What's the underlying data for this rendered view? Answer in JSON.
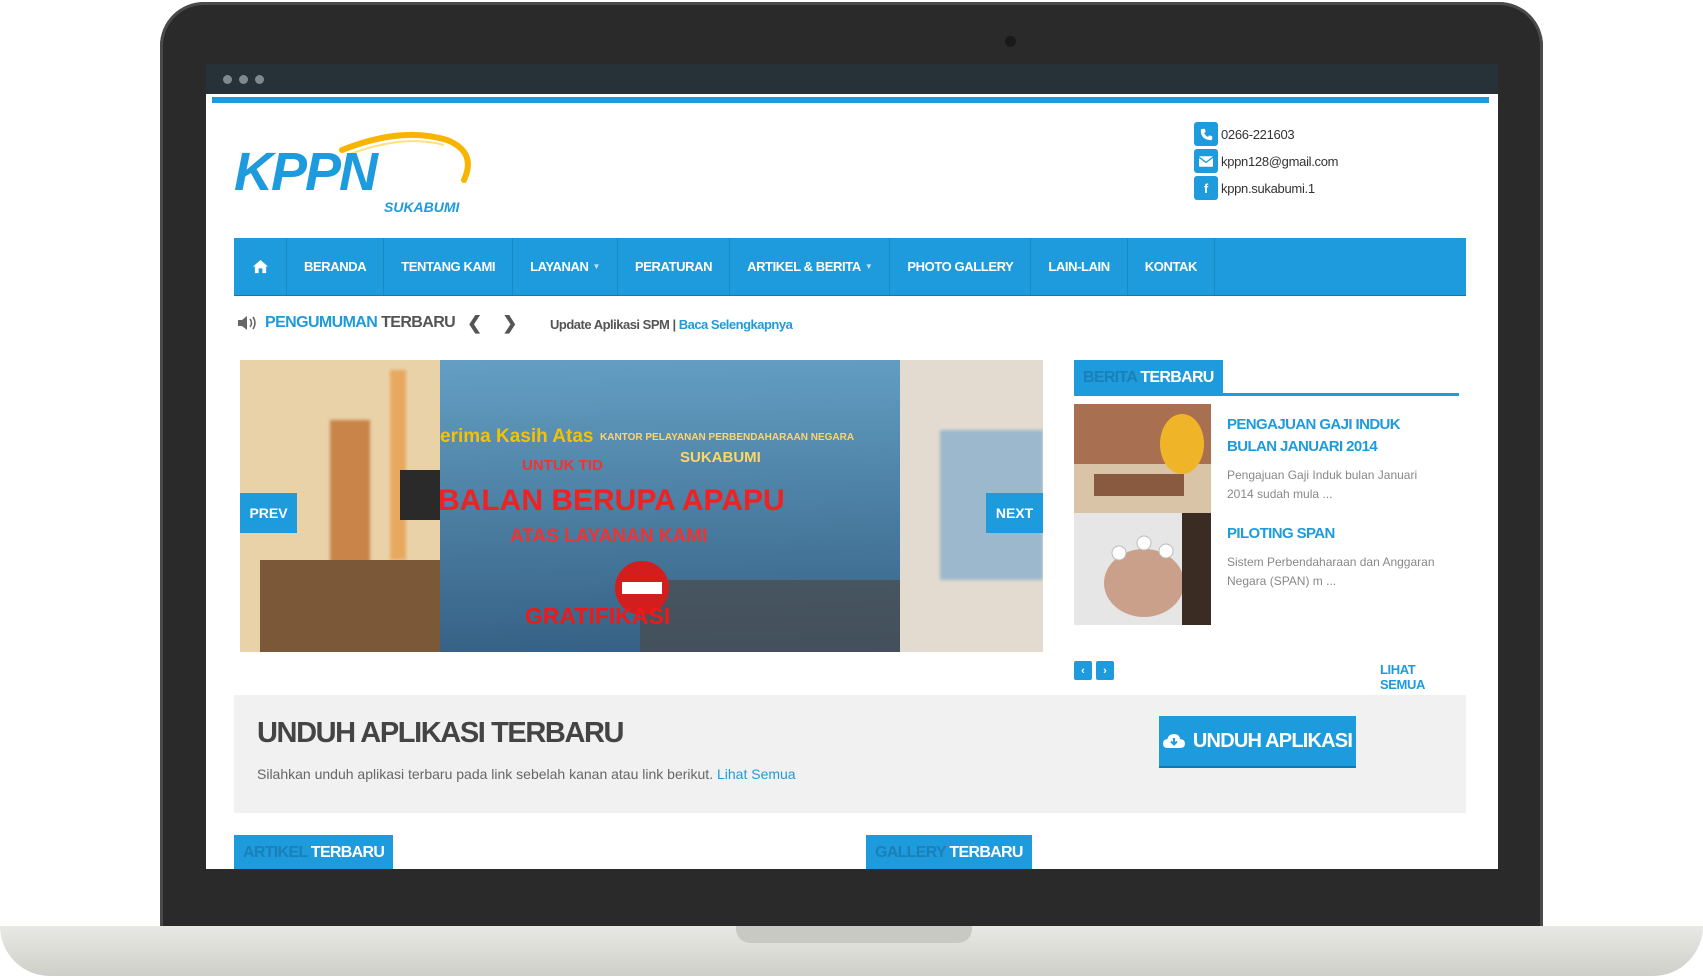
{
  "brand": {
    "logo_main": "KPPN",
    "logo_sub": "SUKABUMI",
    "accent": "#1e9bdc"
  },
  "contact": {
    "phone": "0266-221603",
    "email": "kppn128@gmail.com",
    "facebook": "kppn.sukabumi.1"
  },
  "nav": {
    "home_icon": "home-icon",
    "items": [
      {
        "label": "BERANDA",
        "dropdown": false
      },
      {
        "label": "TENTANG KAMI",
        "dropdown": false
      },
      {
        "label": "LAYANAN",
        "dropdown": true
      },
      {
        "label": "PERATURAN",
        "dropdown": false
      },
      {
        "label": "ARTIKEL & BERITA",
        "dropdown": true
      },
      {
        "label": "PHOTO GALLERY",
        "dropdown": false
      },
      {
        "label": "LAIN-LAIN",
        "dropdown": false
      },
      {
        "label": "KONTAK",
        "dropdown": false
      }
    ]
  },
  "ticker": {
    "label_1": "PENGUMUMAN",
    "label_2": "TERBARU",
    "text": "Update Aplikasi SPM",
    "separator": " | ",
    "link": "Baca Selengkapnya"
  },
  "slider": {
    "prev_label": "PREV",
    "next_label": "NEXT",
    "lines": [
      "erima Kasih Atas",
      "UNTUK TID",
      "BALAN BERUPA APAPU",
      "ATAS LAYANAN KAMI",
      "GRATIFIKASI"
    ],
    "sign_lines": [
      "KANTOR PELAYANAN PERBENDAHARAAN NEGARA",
      "SUKABUMI"
    ]
  },
  "berita": {
    "title_1": "BERITA",
    "title_2": "TERBARU",
    "items": [
      {
        "title": "PENGAJUAN GAJI INDUK BULAN JANUARI 2014",
        "excerpt": "Pengajuan Gaji Induk bulan Januari 2014 sudah mula ..."
      },
      {
        "title": "PILOTING SPAN",
        "excerpt": "Sistem Perbendaharaan dan Anggaran Negara (SPAN) m ..."
      }
    ],
    "see_all": "LIHAT SEMUA"
  },
  "download": {
    "title": "UNDUH APLIKASI TERBARU",
    "text": "Silahkan unduh aplikasi terbaru pada link sebelah kanan atau link berikut.",
    "link": "Lihat Semua",
    "button": "UNDUH APLIKASI"
  },
  "artikel": {
    "title_1": "ARTIKEL",
    "title_2": "TERBARU"
  },
  "gallery": {
    "title_1": "GALLERY",
    "title_2": "TERBARU"
  }
}
